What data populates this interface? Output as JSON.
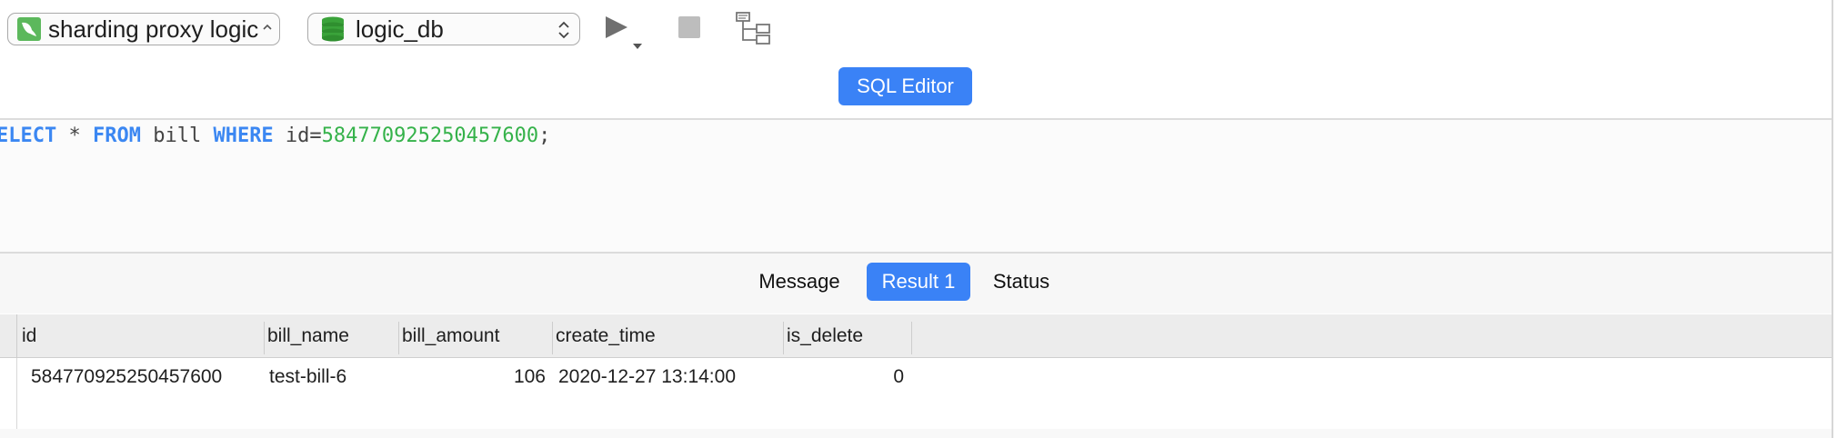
{
  "toolbar": {
    "connection": {
      "label": "sharding proxy logic",
      "icon": "mysql-dolphin-icon",
      "icon_color": "#5cb85c"
    },
    "database": {
      "label": "logic_db",
      "icon": "database-stack-icon",
      "icon_color": "#3aa33a"
    },
    "run_icon": "play-icon",
    "stop_icon": "stop-icon",
    "explain_icon": "explain-tree-icon"
  },
  "editor": {
    "header_button": "SQL Editor",
    "query": {
      "kw_select": "ELECT",
      "star": " * ",
      "kw_from": "FROM",
      "table": " bill ",
      "kw_where": "WHERE",
      "cond": " id=",
      "value": "584770925250457600",
      "end": ";"
    }
  },
  "result_tabs": [
    {
      "label": "Message",
      "active": false
    },
    {
      "label": "Result 1",
      "active": true
    },
    {
      "label": "Status",
      "active": false
    }
  ],
  "grid": {
    "columns": [
      "id",
      "bill_name",
      "bill_amount",
      "create_time",
      "is_delete"
    ],
    "rows": [
      [
        "584770925250457600",
        "test-bill-6",
        "106",
        "2020-12-27 13:14:00",
        "0"
      ]
    ]
  },
  "colors": {
    "accent": "#3a82f6",
    "keyword": "#3b87f2",
    "number": "#35b24a"
  }
}
